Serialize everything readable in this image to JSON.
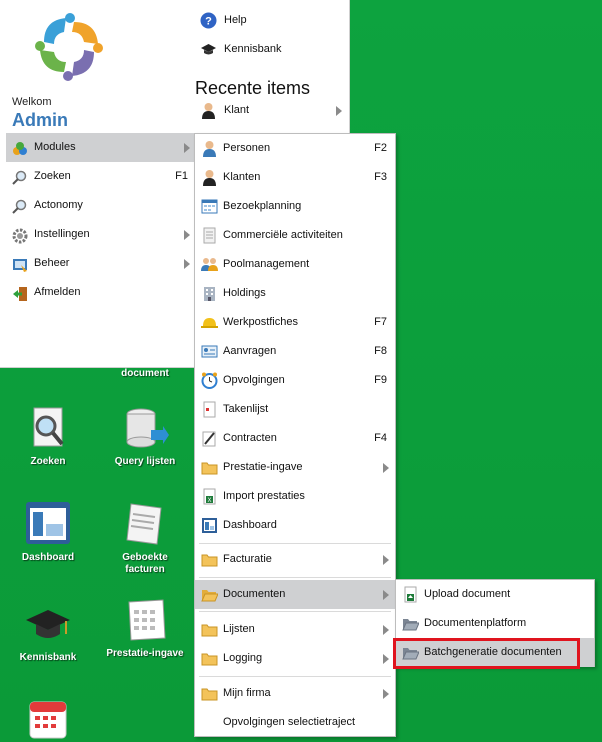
{
  "user": {
    "welcome": "Welkom",
    "name": "Admin"
  },
  "left_menu": [
    {
      "label": "Modules",
      "key": "",
      "submenu": true,
      "active": true,
      "icon": "modules-icon"
    },
    {
      "label": "Zoeken",
      "key": "F1",
      "submenu": false,
      "icon": "search-icon"
    },
    {
      "label": "Actonomy",
      "key": "",
      "submenu": false,
      "icon": "search-icon"
    },
    {
      "label": "Instellingen",
      "key": "",
      "submenu": true,
      "icon": "gear-icon"
    },
    {
      "label": "Beheer",
      "key": "",
      "submenu": true,
      "icon": "admin-icon"
    },
    {
      "label": "Afmelden",
      "key": "",
      "submenu": false,
      "icon": "logout-icon"
    }
  ],
  "right_col": {
    "help": "Help",
    "kennisbank": "Kennisbank",
    "recent_title": "Recente items",
    "recent_items": [
      {
        "label": "Klant"
      }
    ]
  },
  "modules_menu": [
    {
      "label": "Personen",
      "key": "F2"
    },
    {
      "label": "Klanten",
      "key": "F3"
    },
    {
      "label": "Bezoekplanning",
      "key": ""
    },
    {
      "label": "Commerciële activiteiten",
      "key": ""
    },
    {
      "label": "Poolmanagement",
      "key": ""
    },
    {
      "label": "Holdings",
      "key": ""
    },
    {
      "label": "Werkpostfiches",
      "key": "F7"
    },
    {
      "label": "Aanvragen",
      "key": "F8"
    },
    {
      "label": "Opvolgingen",
      "key": "F9"
    },
    {
      "label": "Takenlijst",
      "key": ""
    },
    {
      "label": "Contracten",
      "key": "F4"
    },
    {
      "label": "Prestatie-ingave",
      "key": ""
    },
    {
      "label": "Import prestaties",
      "key": ""
    },
    {
      "label": "Dashboard",
      "key": ""
    },
    {
      "label": "Facturatie",
      "key": ""
    },
    {
      "label": "Documenten",
      "key": ""
    },
    {
      "label": "Lijsten",
      "key": ""
    },
    {
      "label": "Logging",
      "key": ""
    },
    {
      "label": "Mijn firma",
      "key": ""
    },
    {
      "label": "Opvolgingen selectietraject",
      "key": ""
    }
  ],
  "documenten_menu": [
    {
      "label": "Upload document"
    },
    {
      "label": "Documentenplatform"
    },
    {
      "label": "Batchgeneratie documenten"
    }
  ],
  "desktop": {
    "partial_label": "document",
    "icons": [
      {
        "label": "Zoeken"
      },
      {
        "label": "Query lijsten"
      },
      {
        "label": "Dashboard"
      },
      {
        "label": "Geboekte facturen"
      },
      {
        "label": "Kennisbank"
      },
      {
        "label": "Prestatie-ingave"
      }
    ]
  },
  "colors": {
    "accent": "#3a7ab8",
    "desktop_bg": "#0a9a3a",
    "highlight": "#e0141e",
    "menu_active": "#cfd0d2"
  }
}
